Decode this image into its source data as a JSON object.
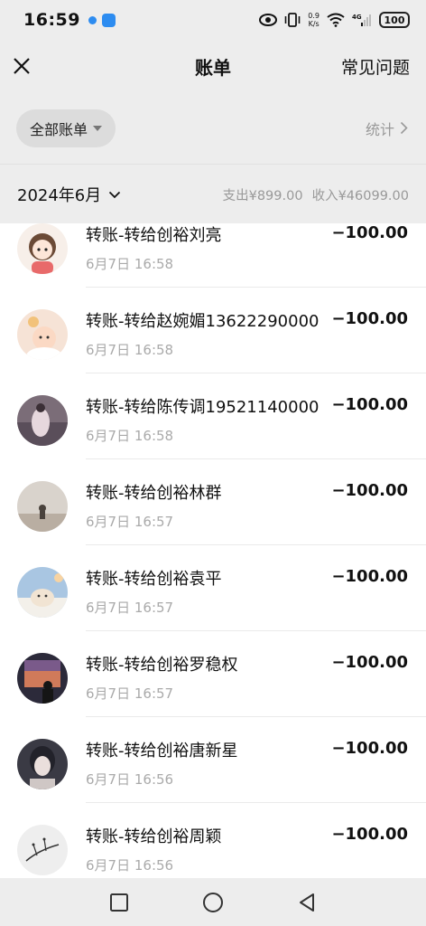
{
  "status": {
    "time": "16:59",
    "net_speed_value": "0.9",
    "net_speed_unit": "K/s",
    "signal_label": "4G",
    "battery": "100"
  },
  "nav": {
    "title": "账单",
    "faq": "常见问题"
  },
  "filter": {
    "chip_label": "全部账单",
    "stats_label": "统计"
  },
  "month": {
    "label": "2024年6月",
    "expense": "支出¥899.00",
    "income": "收入¥46099.00"
  },
  "transactions": [
    {
      "title": "转账-转给创裕刘亮",
      "time": "6月7日 16:58",
      "amount": "−100.00"
    },
    {
      "title": "转账-转给赵婉媚13622290000",
      "time": "6月7日 16:58",
      "amount": "−100.00"
    },
    {
      "title": "转账-转给陈传调19521140000",
      "time": "6月7日 16:58",
      "amount": "−100.00"
    },
    {
      "title": "转账-转给创裕林群",
      "time": "6月7日 16:57",
      "amount": "−100.00"
    },
    {
      "title": "转账-转给创裕袁平",
      "time": "6月7日 16:57",
      "amount": "−100.00"
    },
    {
      "title": "转账-转给创裕罗稳权",
      "time": "6月7日 16:57",
      "amount": "−100.00"
    },
    {
      "title": "转账-转给创裕唐新星",
      "time": "6月7日 16:56",
      "amount": "−100.00"
    },
    {
      "title": "转账-转给创裕周颖",
      "time": "6月7日 16:56",
      "amount": "−100.00"
    }
  ],
  "colors": {
    "background": "#ededed",
    "list_bg": "#ffffff",
    "muted": "#999999",
    "accent_dot": "#2d8cf0"
  }
}
